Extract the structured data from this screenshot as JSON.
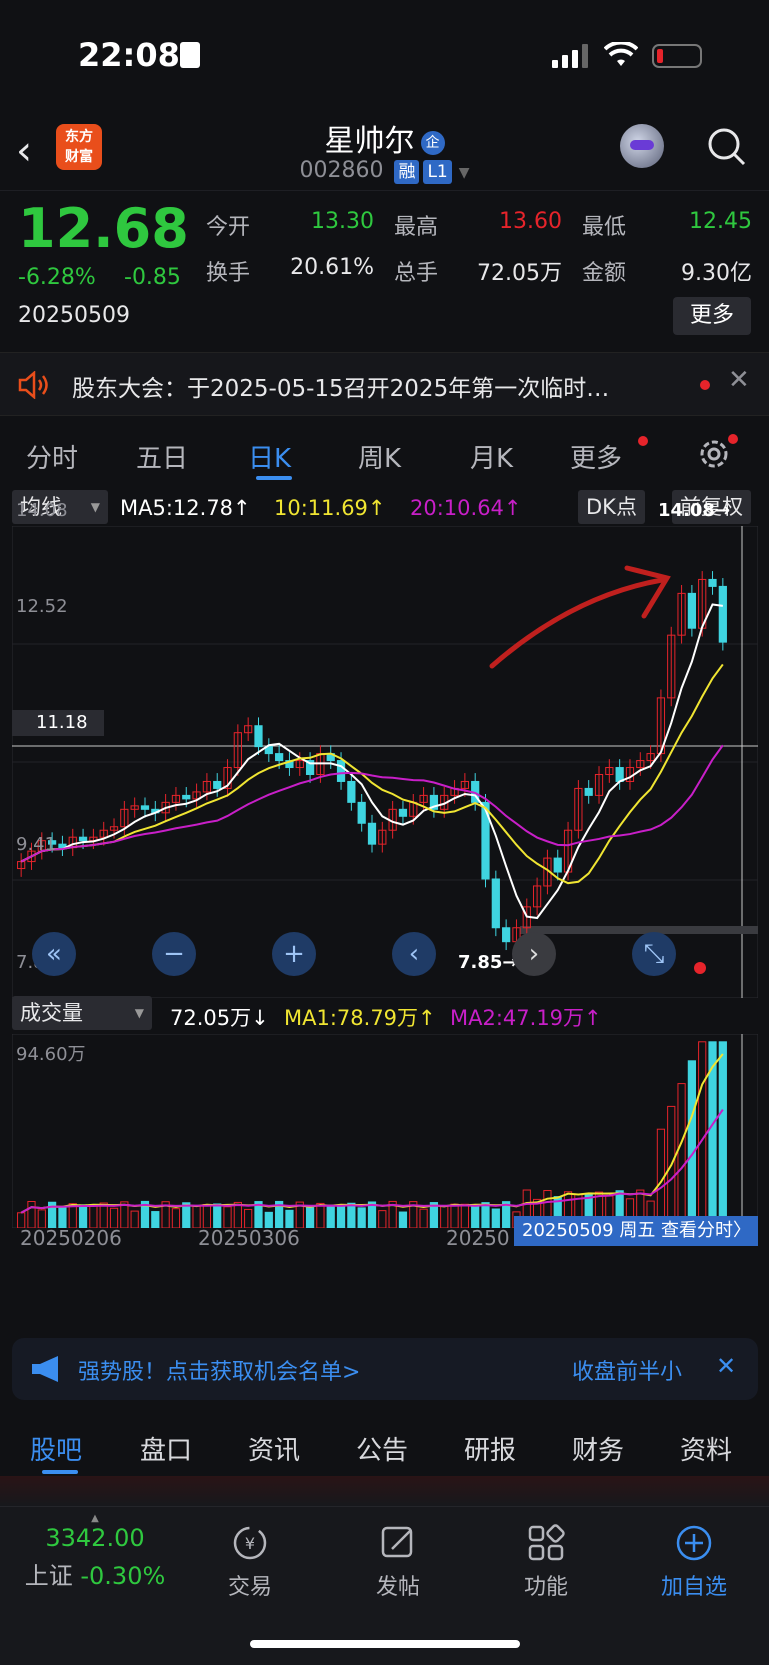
{
  "status_bar": {
    "time": "22:08"
  },
  "header": {
    "brand": "东方\n财富",
    "brand_line1": "东方",
    "brand_line2": "财富",
    "stock_name": "星帅尔",
    "badge_qiye": "企",
    "code": "002860",
    "tag_rong": "融",
    "tag_level": "L1"
  },
  "quote": {
    "price": "12.68",
    "change_pct": "-6.28%",
    "change_amt": "-0.85",
    "date": "20250509",
    "open_label": "今开",
    "open": "13.30",
    "high_label": "最高",
    "high": "13.60",
    "low_label": "最低",
    "low": "12.45",
    "turnover_label": "换手",
    "turnover": "20.61%",
    "volume_label": "总手",
    "volume": "72.05万",
    "amount_label": "金额",
    "amount": "9.30亿",
    "more_button": "更多"
  },
  "notice": {
    "text": "股东大会：于2025-05-15召开2025年第一次临时…"
  },
  "chart_tabs": [
    "分时",
    "五日",
    "日K",
    "周K",
    "月K",
    "更多"
  ],
  "active_chart_tab": "日K",
  "kline": {
    "indicator_select": "均线",
    "ma5": "MA5:12.78↑",
    "ma10": "10:11.69↑",
    "ma20": "20:10.64↑",
    "dk_button": "DK点",
    "adjust_button": "前复权",
    "y_top": "14.08",
    "y_mid": "12.52",
    "y_cross": "11.18",
    "y_low": "9.41",
    "y_bottom": "7.85",
    "max_label": "14.08",
    "min_label": "7.85"
  },
  "volume_panel": {
    "indicator_select": "成交量",
    "value": "72.05万↓",
    "ma1": "MA1:78.79万↑",
    "ma2": "MA2:47.19万↑",
    "y_top": "94.60万"
  },
  "x_axis": {
    "d1": "20250206",
    "d2": "20250306",
    "d3": "20250",
    "tooltip": "20250509 周五 查看分时〉"
  },
  "promo": {
    "text": "强势股！点击获取机会名单>",
    "right": "收盘前半小"
  },
  "bottom_tabs": [
    "股吧",
    "盘口",
    "资讯",
    "公告",
    "研报",
    "财务",
    "资料"
  ],
  "footer": {
    "index_value": "3342.00",
    "index_name": "上证",
    "index_change": "-0.30%",
    "trade": "交易",
    "post": "发帖",
    "functions": "功能",
    "add_watch": "加自选"
  },
  "colors": {
    "up": "#e6242b",
    "down": "#3fd4e0",
    "ma5": "#ffffff",
    "ma10": "#f0e532",
    "ma20": "#c81fc8",
    "accent": "#3b8ef0",
    "price_down": "#2fc83f"
  }
}
